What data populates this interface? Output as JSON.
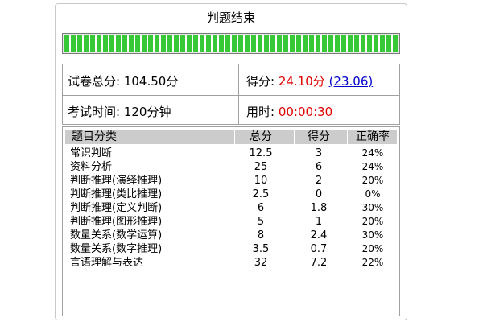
{
  "window": {
    "title": "判题结束"
  },
  "progress": {
    "fraction": 1.0,
    "color": "#36c836"
  },
  "summary": {
    "total_label": "试卷总分:",
    "total_value": "104.50分",
    "score_label": "得分:",
    "score_value": "24.10分",
    "score_link": "(23.06)",
    "time_label": "考试时间:",
    "time_value": "120分钟",
    "elapsed_label": "用时:",
    "elapsed_value": "00:00:30"
  },
  "stats": {
    "headers": [
      "题目分类",
      "总分",
      "得分",
      "正确率"
    ],
    "rows": [
      [
        "常识判断",
        "12.5",
        "3",
        "24%"
      ],
      [
        "资料分析",
        "25",
        "6",
        "24%"
      ],
      [
        "判断推理(演绎推理)",
        "10",
        "2",
        "20%"
      ],
      [
        "判断推理(类比推理)",
        "2.5",
        "0",
        "0%"
      ],
      [
        "判断推理(定义判断)",
        "6",
        "1.8",
        "30%"
      ],
      [
        "判断推理(图形推理)",
        "5",
        "1",
        "20%"
      ],
      [
        "数量关系(数学运算)",
        "8",
        "2.4",
        "30%"
      ],
      [
        "数量关系(数字推理)",
        "3.5",
        "0.7",
        "20%"
      ],
      [
        "言语理解与表达",
        "32",
        "7.2",
        "22%"
      ]
    ]
  },
  "colors": {
    "accent_red": "#e00000",
    "link_blue": "#0000cc",
    "header_bg": "#cccccc"
  }
}
